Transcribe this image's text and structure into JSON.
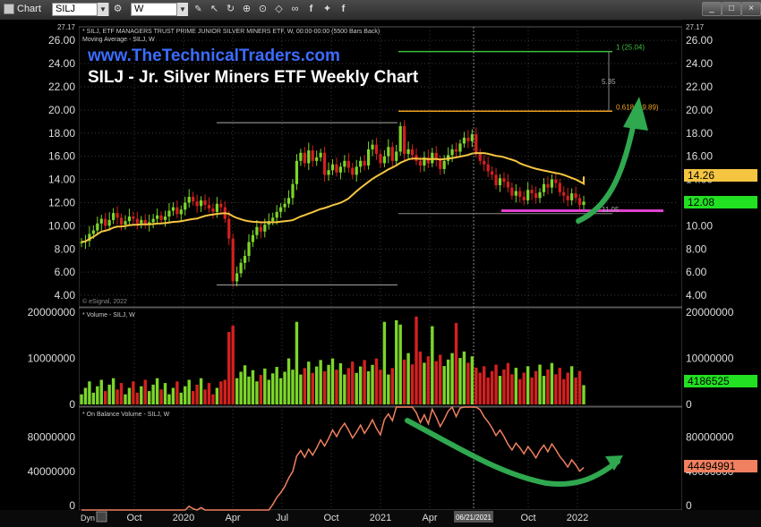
{
  "toolbar": {
    "app_label": "Chart",
    "symbol_value": "SILJ",
    "interval_value": "W",
    "icons": [
      "settings-icon",
      "pencil-icon",
      "cursor-icon",
      "refresh-icon",
      "crosshair-icon",
      "zoom-icon",
      "eraser-icon",
      "link-icon",
      "facebook-icon",
      "twitter-icon",
      "f-icon"
    ]
  },
  "overlay": {
    "website": "www.TheTechnicalTraders.com",
    "headline": "SILJ - Jr. Silver Miners ETF Weekly Chart"
  },
  "price_panel": {
    "header_line1": "* SILJ, ETF MANAGERS TRUST PRIME JUNIOR SILVER MINERS ETF, W, 00:00-00:00 (5500 Bars Back)",
    "header_line2": "Moving Average - SILJ, W",
    "watermark": "© eSignal, 2022",
    "top_value": "27.17",
    "right_top_value": "27.17",
    "last_price_label": "12.08",
    "ma_value_label": "14.26",
    "fib_100_label": "1 (25.04)",
    "fib_618_label": "0.618 (19.89)",
    "measure_label": "5.35",
    "low_label": "11.05"
  },
  "volume_panel": {
    "header": "* Volume - SILJ, W",
    "last_value_label": "4186525"
  },
  "obv_panel": {
    "header": "* On Balance Volume - SILJ, W",
    "last_value_label": "44494991"
  },
  "time_axis": {
    "corner_label": "Dyn",
    "highlight_label": "06/21/2021"
  },
  "colors": {
    "up_candle": "#7cd62a",
    "down_candle": "#d42020",
    "moving_average": "#f5c542",
    "obv_line": "#f08060",
    "support_line": "#e040d0",
    "arrow_green": "#2fa84f",
    "fib_green": "#3bbf3b",
    "fib_orange": "#f0a020",
    "website_text": "#3c6cff"
  },
  "chart_data": [
    {
      "type": "candlestick",
      "title": "SILJ, ETF MANAGERS TRUST PRIME JUNIOR SILVER MINERS ETF, W",
      "x_ticks": [
        "Oct",
        "2020",
        "Apr",
        "Jul",
        "Oct",
        "2021",
        "Apr",
        "06/21/2021",
        "Oct",
        "2022"
      ],
      "y_ticks": [
        "4.00",
        "6.00",
        "8.00",
        "10.00",
        "12.00",
        "14.00",
        "16.00",
        "18.00",
        "20.00",
        "22.00",
        "24.00",
        "26.00"
      ],
      "ylim": [
        3.0,
        27.17
      ],
      "weekly_close": [
        8.6,
        8.7,
        9.3,
        9.6,
        10.2,
        10.6,
        10.0,
        10.5,
        11.1,
        10.7,
        10.1,
        10.4,
        10.8,
        10.6,
        10.2,
        10.5,
        10.1,
        10.3,
        10.6,
        10.9,
        10.5,
        10.8,
        11.3,
        11.6,
        11.0,
        11.4,
        12.0,
        12.5,
        12.1,
        11.7,
        12.2,
        11.8,
        11.5,
        11.2,
        11.9,
        11.6,
        10.6,
        8.9,
        5.2,
        5.9,
        6.8,
        7.4,
        8.6,
        9.2,
        9.9,
        9.5,
        10.1,
        10.4,
        10.7,
        11.2,
        11.6,
        11.9,
        12.4,
        13.6,
        15.6,
        16.3,
        15.4,
        16.5,
        15.6,
        15.9,
        16.3,
        14.4,
        14.8,
        15.3,
        14.6,
        15.1,
        15.6,
        15.0,
        14.4,
        15.1,
        15.6,
        15.2,
        16.6,
        17.0,
        16.2,
        15.4,
        16.0,
        16.8,
        15.6,
        16.4,
        18.6,
        16.2,
        16.6,
        16.1,
        15.6,
        15.2,
        15.9,
        15.4,
        16.3,
        15.7,
        14.9,
        15.6,
        16.1,
        16.6,
        16.4,
        17.1,
        17.6,
        17.3,
        17.9,
        16.3,
        15.6,
        15.3,
        14.7,
        14.4,
        13.5,
        14.1,
        13.8,
        13.3,
        12.6,
        13.0,
        12.5,
        12.2,
        13.1,
        12.8,
        12.4,
        12.9,
        13.6,
        13.3,
        14.0,
        13.7,
        12.9,
        12.6,
        12.2,
        12.8,
        12.4,
        11.8,
        12.08
      ],
      "moving_average_last": 14.26,
      "fibonacci_levels": [
        {
          "ratio": 1,
          "price": 25.04
        },
        {
          "ratio": 0.618,
          "price": 19.89
        }
      ],
      "measured_move": 5.35,
      "swing_high": 18.9,
      "swing_low": 4.9,
      "support_level": 11.05,
      "last_price": 12.08
    },
    {
      "type": "bar",
      "title": "Volume - SILJ, W",
      "y_ticks": [
        "0",
        "10000000",
        "20000000"
      ],
      "ylim": [
        0,
        21000000
      ],
      "last_value": 4186525
    },
    {
      "type": "line",
      "title": "On Balance Volume - SILJ, W",
      "y_ticks": [
        "0",
        "40000000",
        "80000000"
      ],
      "ylim": [
        -5000000,
        115000000
      ],
      "last_value": 44494991
    }
  ]
}
